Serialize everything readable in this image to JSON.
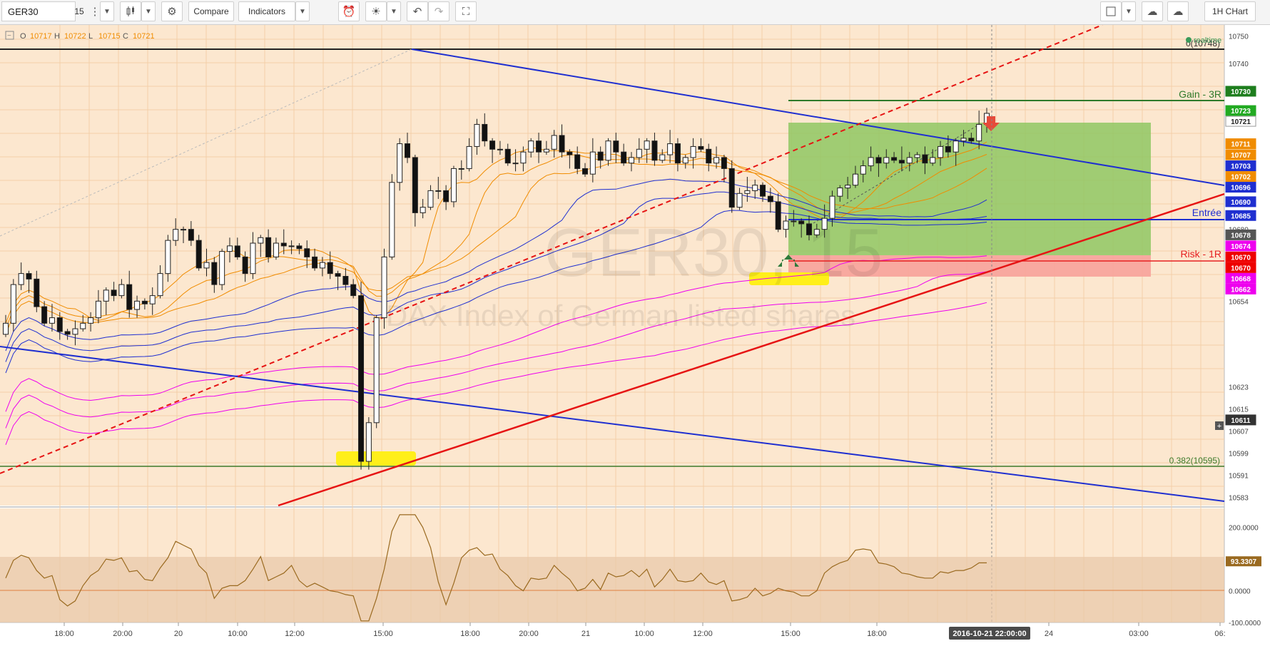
{
  "toolbar": {
    "symbol": "GER30",
    "interval": "15",
    "compare_label": "Compare",
    "indicators_label": "Indicators",
    "timeframe_label": "1H CHart"
  },
  "legend": {
    "ohlc": [
      {
        "key": "O",
        "value": "10717"
      },
      {
        "key": "H",
        "value": "10722"
      },
      {
        "key": "L",
        "value": "10715"
      },
      {
        "key": "C",
        "value": "10721"
      }
    ],
    "realtime_label": "realtime"
  },
  "watermark": {
    "title": "GER30, 15",
    "subtitle": "DAX Index of German listed shares"
  },
  "annotations": {
    "fib_top": "0(10748)",
    "fib_382": "0.382(10595)",
    "gain": "Gain - 3R",
    "entry": "Entrée",
    "risk": "Risk - 1R"
  },
  "chart_data": {
    "type": "candlestick",
    "ylim": [
      10580,
      10754
    ],
    "y_ticks": [
      10750,
      10740,
      10730,
      10721,
      10711,
      10707,
      10703,
      10702,
      10696,
      10690,
      10680,
      10670,
      10662,
      10654,
      10623,
      10615,
      10607,
      10599,
      10591,
      10583
    ],
    "x_ticks": [
      "18:00",
      "20:00",
      "20",
      "10:00",
      "12:00",
      "15:00",
      "18:00",
      "20:00",
      "21",
      "10:00",
      "12:00",
      "15:00",
      "18:00",
      "24",
      "03:00",
      "06:"
    ],
    "price_badges": [
      {
        "value": "10730",
        "color": "#1e7e1e"
      },
      {
        "value": "10723",
        "color": "#22aa22"
      },
      {
        "value": "10721",
        "color": "#ffffff"
      },
      {
        "value": "10711",
        "color": "#f08c00"
      },
      {
        "value": "10707",
        "color": "#f08c00"
      },
      {
        "value": "10703",
        "color": "#1f2fd0"
      },
      {
        "value": "10702",
        "color": "#f08c00"
      },
      {
        "value": "10696",
        "color": "#1f2fd0"
      },
      {
        "value": "10690",
        "color": "#1f2fd0"
      },
      {
        "value": "10685",
        "color": "#1f2fd0"
      },
      {
        "value": "10678",
        "color": "#555555"
      },
      {
        "value": "10674",
        "color": "#ee00ee"
      },
      {
        "value": "10670",
        "color": "#ee0000"
      },
      {
        "value": "10670",
        "color": "#ee0000"
      },
      {
        "value": "10668",
        "color": "#ee00ee"
      },
      {
        "value": "10662",
        "color": "#ee00ee"
      },
      {
        "value": "10611",
        "color": "#333333"
      }
    ],
    "candles_close": [
      10646,
      10660,
      10664,
      10662,
      10652,
      10646,
      10648,
      10643,
      10642,
      10644,
      10646,
      10648,
      10654,
      10658,
      10656,
      10660,
      10651,
      10654,
      10653,
      10656,
      10664,
      10676,
      10680,
      10680,
      10676,
      10666,
      10668,
      10660,
      10672,
      10674,
      10670,
      10664,
      10675,
      10677,
      10670,
      10675,
      10674,
      10674,
      10673,
      10670,
      10666,
      10668,
      10664,
      10663,
      10660,
      10656,
      10596,
      10610,
      10648,
      10670,
      10697,
      10711,
      10706,
      10686,
      10688,
      10694,
      10694,
      10690,
      10702,
      10702,
      10710,
      10718,
      10712,
      10709,
      10709,
      10704,
      10704,
      10708,
      10712,
      10708,
      10709,
      10714,
      10708,
      10707,
      10702,
      10700,
      10708,
      10705,
      10712,
      10708,
      10704,
      10706,
      10709,
      10712,
      10705,
      10707,
      10711,
      10704,
      10706,
      10710,
      10709,
      10704,
      10706,
      10702,
      10688,
      10693,
      10694,
      10696,
      10692,
      10690,
      10680,
      10683,
      10683,
      10682,
      10678,
      10680,
      10684,
      10692,
      10695,
      10696,
      10700,
      10703,
      10706,
      10704,
      10706,
      10705,
      10704,
      10706,
      10707,
      10704,
      10706,
      10710,
      10708,
      10712,
      10713,
      10712,
      10718,
      10722
    ],
    "entry_price": 10685,
    "gain_price": 10730,
    "risk_price": 10670,
    "fib_levels": [
      {
        "ratio": 0,
        "value": 10748
      },
      {
        "ratio": 0.382,
        "value": 10595
      }
    ],
    "oscillator": {
      "last_value": "93.3307",
      "levels": [
        "200.0000",
        "0.0000",
        "-100.0000"
      ],
      "ylim": [
        -100,
        260
      ]
    },
    "date_label": "2016-10-21 22:00:00"
  }
}
